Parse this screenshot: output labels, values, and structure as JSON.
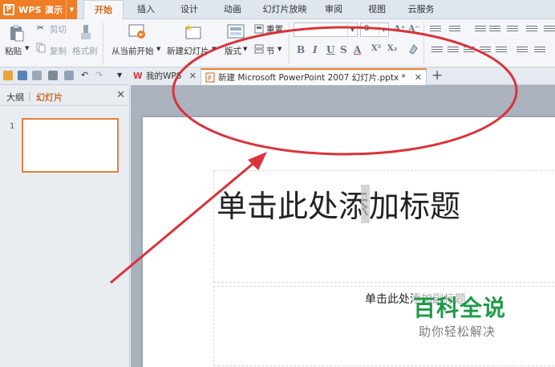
{
  "app": {
    "name": "WPS 演示"
  },
  "menu": {
    "tabs": [
      {
        "label": "开始",
        "active": true
      },
      {
        "label": "插入"
      },
      {
        "label": "设计"
      },
      {
        "label": "动画"
      },
      {
        "label": "幻灯片放映"
      },
      {
        "label": "审阅"
      },
      {
        "label": "视图"
      },
      {
        "label": "云服务"
      }
    ]
  },
  "ribbon": {
    "paste": "粘贴",
    "cut": "剪切",
    "copy": "复制",
    "format_painter": "格式刷",
    "from_current": "从当前开始",
    "new_slide": "新建幻灯片",
    "layout": "版式",
    "reset": "重置",
    "section": "节",
    "font_size_value": "0",
    "bold": "B",
    "italic": "I",
    "underline": "U",
    "strike": "S",
    "font_color": "A",
    "superscript": "X²",
    "subscript": "X₂",
    "grow_font": "A⁺",
    "shrink_font": "A⁻"
  },
  "doc_tabs": [
    {
      "label": "我的WPS"
    },
    {
      "label": "新建 Microsoft PowerPoint 2007 幻灯片.pptx *",
      "active": true
    }
  ],
  "left_pane": {
    "tab_outline": "大纲",
    "tab_slides": "幻灯片",
    "slide_number": "1"
  },
  "slide": {
    "title": "单击此处添加标题",
    "subtitle": "单击此处添加副标题"
  },
  "watermark": {
    "title": "百科全说",
    "subtitle": "助你轻松解决"
  },
  "colors": {
    "accent": "#ef7d26",
    "annotation": "#d9333b",
    "watermark": "#1f9b4a"
  }
}
